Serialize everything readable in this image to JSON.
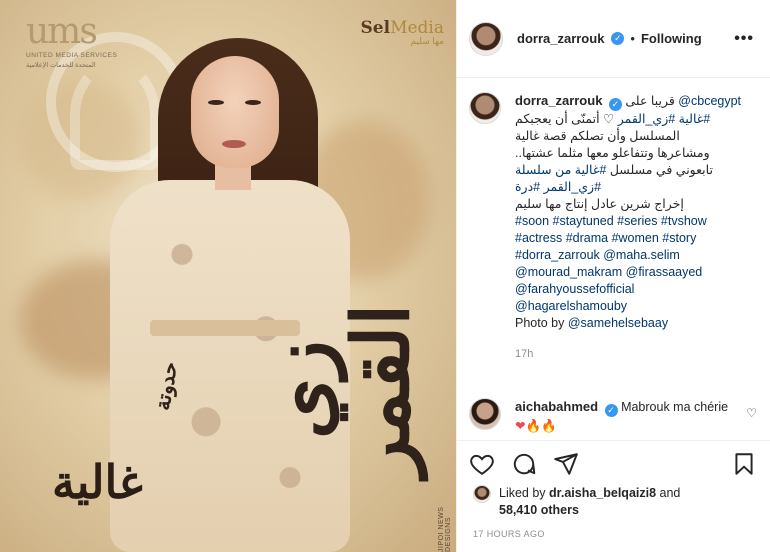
{
  "poster": {
    "logo_left_mark": "ums",
    "logo_left_sub": "UNITED MEDIA SERVICES",
    "logo_left_sub_ar": "المتحدة للخدمات الإعلامية",
    "logo_right_main": "Sel",
    "logo_right_accent": "Media",
    "logo_right_ar": "مها سليم",
    "title_main": "زي القمر",
    "title_small": "حدوتة",
    "title_name": "غالية",
    "credit": "JIPOI NEWS DESIGNS"
  },
  "header": {
    "username": "dorra_zarrouk",
    "separator": "•",
    "follow_status": "Following",
    "more_icon": "more-options-icon"
  },
  "caption": {
    "username": "dorra_zarrouk",
    "line1_ar": "قريبا على",
    "line1_tag": "@cbcegypt",
    "line2_tag1": "#غالية",
    "line2_tag2": "#زي_القمر",
    "line2_text": "أتمنّى أن يعجبكم",
    "line3": "المسلسل وأن تصلكم قصة غالية",
    "line4": "ومشاعرها وتتفاعلو معها مثلما عشتها..",
    "line5_text": "تابعوني في مسلسل",
    "line5_tag": "#غالية من سلسلة",
    "line6_tags": "#زي_القمر #درة",
    "line7": "إخراج شرين عادل إنتاج مها سليم",
    "tags_line1": "#soon #staytuned #series #tvshow",
    "tags_line2": "#actress #drama #women #story",
    "mention_line1": "#dorra_zarrouk @maha.selim",
    "mention_line2": "@mourad_makram @firassaayed",
    "mention_line3": "@farahyoussefofficial",
    "mention_line4": "@hagarelshamouby",
    "photo_by_label": "Photo by",
    "photo_by_user": "@samehelsebaay",
    "time": "17h"
  },
  "comment": {
    "username": "aichabahmed",
    "text": "Mabrouk ma chérie",
    "emoji": "❤🔥🔥"
  },
  "actions": {
    "like_icon": "heart-icon",
    "comment_icon": "comment-icon",
    "share_icon": "share-icon",
    "save_icon": "bookmark-icon",
    "liked_by_label": "Liked by",
    "liked_by_user": "dr.aisha_belqaizi8",
    "and_label": "and",
    "others_count": "58,410 others",
    "timestamp": "17 HOURS AGO"
  },
  "colors": {
    "link": "#00376b",
    "verified": "#3897f0",
    "muted": "#8e8e8e"
  }
}
